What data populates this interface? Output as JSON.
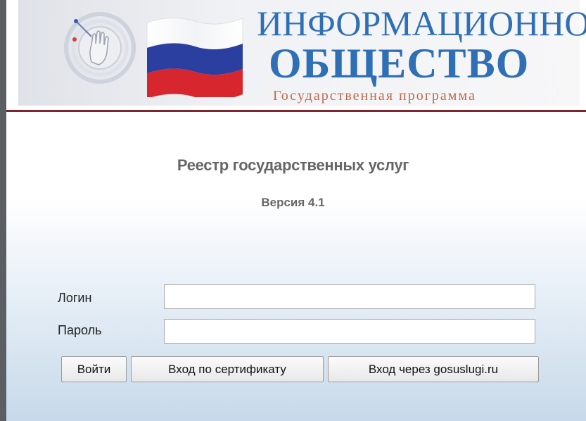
{
  "header": {
    "title_top": "ИНФОРМАЦИОННОЕ",
    "title_main": "ОБЩЕСТВО",
    "subtitle": "Государственная программа",
    "flag_colors": [
      "#ffffff",
      "#2b3fa0",
      "#d8262e"
    ],
    "accent_color": "#7d2630",
    "title_color": "#2f6fb5"
  },
  "main": {
    "registry_title": "Реестр государственных услуг",
    "version": "Версия 4.1"
  },
  "form": {
    "login_label": "Логин",
    "login_value": "",
    "password_label": "Пароль",
    "password_value": ""
  },
  "buttons": {
    "login": "Войти",
    "certificate": "Вход по сертификату",
    "gosuslugi": "Вход через gosuslugi.ru"
  }
}
